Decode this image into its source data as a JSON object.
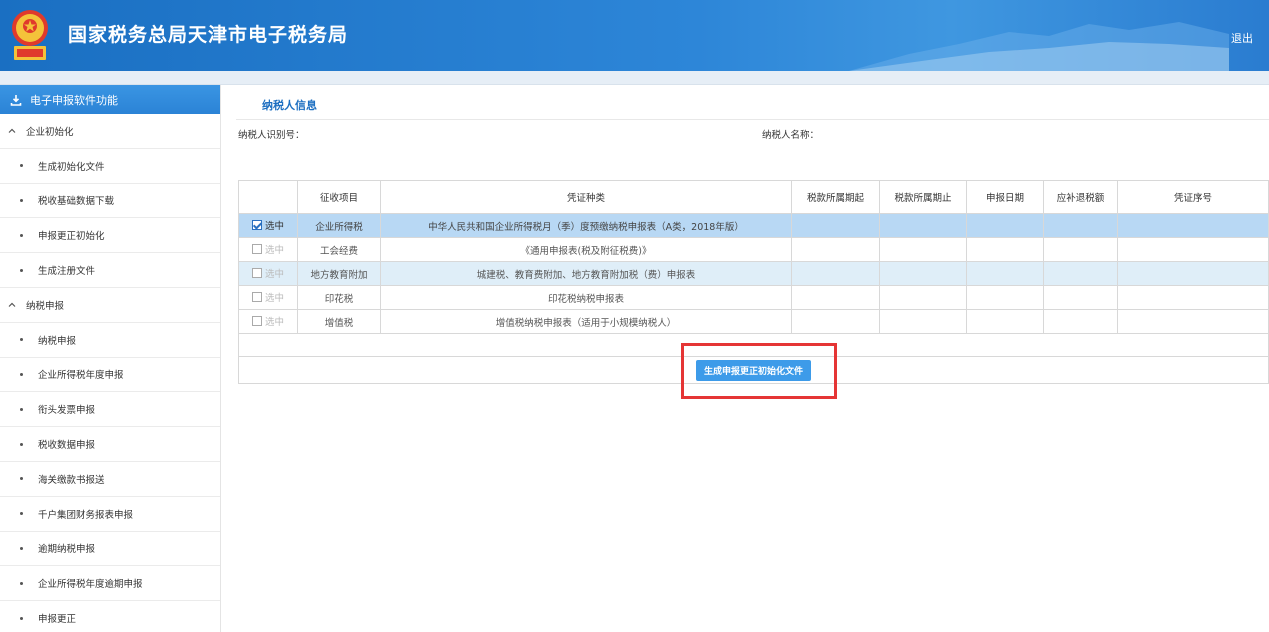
{
  "header": {
    "title": "国家税务总局天津市电子税务局",
    "logout": "退出"
  },
  "sidebar": {
    "title": "电子申报软件功能",
    "items": [
      {
        "type": "group",
        "label": "企业初始化"
      },
      {
        "type": "sub",
        "label": "生成初始化文件"
      },
      {
        "type": "sub",
        "label": "税收基础数据下载"
      },
      {
        "type": "sub",
        "label": "申报更正初始化"
      },
      {
        "type": "sub",
        "label": "生成注册文件"
      },
      {
        "type": "group",
        "label": "纳税申报"
      },
      {
        "type": "sub",
        "label": "纳税申报"
      },
      {
        "type": "sub",
        "label": "企业所得税年度申报"
      },
      {
        "type": "sub",
        "label": "衔头发票申报"
      },
      {
        "type": "sub",
        "label": "税收数据申报"
      },
      {
        "type": "sub",
        "label": "海关缴款书报送"
      },
      {
        "type": "sub",
        "label": "千户集团财务报表申报"
      },
      {
        "type": "sub",
        "label": "逾期纳税申报"
      },
      {
        "type": "sub",
        "label": "企业所得税年度逾期申报"
      },
      {
        "type": "sub",
        "label": "申报更正"
      }
    ]
  },
  "main": {
    "section_title": "纳税人信息",
    "taxpayer_id_label": "纳税人识别号：",
    "taxpayer_name_label": "纳税人名称：",
    "table": {
      "headers": [
        "",
        "征收项目",
        "凭证种类",
        "税款所属期起",
        "税款所属期止",
        "申报日期",
        "应补退税额",
        "凭证序号"
      ],
      "rows": [
        {
          "checked": true,
          "check_label": "选中",
          "item": "企业所得税",
          "voucher": "中华人民共和国企业所得税月（季）度预缴纳税申报表（A类，2018年版）"
        },
        {
          "checked": false,
          "check_label": "选中",
          "item": "工会经费",
          "voucher": "《通用申报表(税及附征税费)》"
        },
        {
          "checked": false,
          "check_label": "选中",
          "item": "地方教育附加",
          "voucher": "城建税、教育费附加、地方教育附加税（费）申报表"
        },
        {
          "checked": false,
          "check_label": "选中",
          "item": "印花税",
          "voucher": "印花税纳税申报表"
        },
        {
          "checked": false,
          "check_label": "选中",
          "item": "增值税",
          "voucher": "增值税纳税申报表（适用于小规模纳税人）"
        }
      ]
    },
    "generate_button": "生成申报更正初始化文件"
  },
  "colors": {
    "header_blue": "#2a7fd2",
    "accent": "#3d9be9",
    "selected_row": "#b8d8f4",
    "highlight_box": "#e53535"
  }
}
